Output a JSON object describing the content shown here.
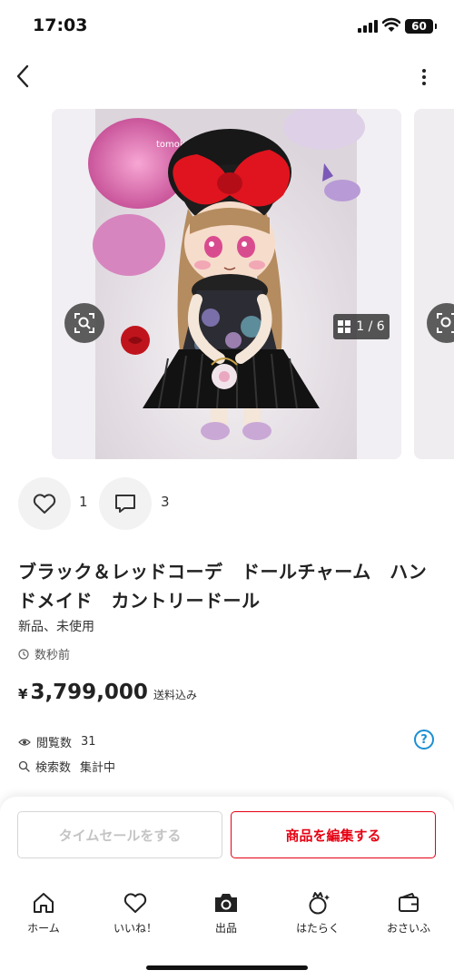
{
  "status_bar": {
    "time": "17:03",
    "battery": "60"
  },
  "gallery": {
    "counter": "1 / 6",
    "photo_watermark": "tomokichi"
  },
  "actions": {
    "like_count": "1",
    "comment_count": "3"
  },
  "item": {
    "title": "ブラック＆レッドコーデ　ドールチャーム　ハンドメイド　カントリードール",
    "condition": "新品、未使用",
    "posted": "数秒前",
    "price_currency": "¥",
    "price": "3,799,000",
    "shipping": "送料込み"
  },
  "stats": {
    "views_label": "閲覧数",
    "views_value": "31",
    "search_label": "検索数",
    "search_value": "集計中"
  },
  "buttons": {
    "time_sale": "タイムセールをする",
    "edit": "商品を編集する"
  },
  "tabs": [
    {
      "label": "ホーム",
      "icon": "home-icon"
    },
    {
      "label": "いいね！",
      "icon": "heart-icon"
    },
    {
      "label": "出品",
      "icon": "camera-icon"
    },
    {
      "label": "はたらく",
      "icon": "work-icon"
    },
    {
      "label": "おさいふ",
      "icon": "wallet-icon"
    }
  ],
  "colors": {
    "accent": "#e60012",
    "help": "#1a8fd3"
  }
}
